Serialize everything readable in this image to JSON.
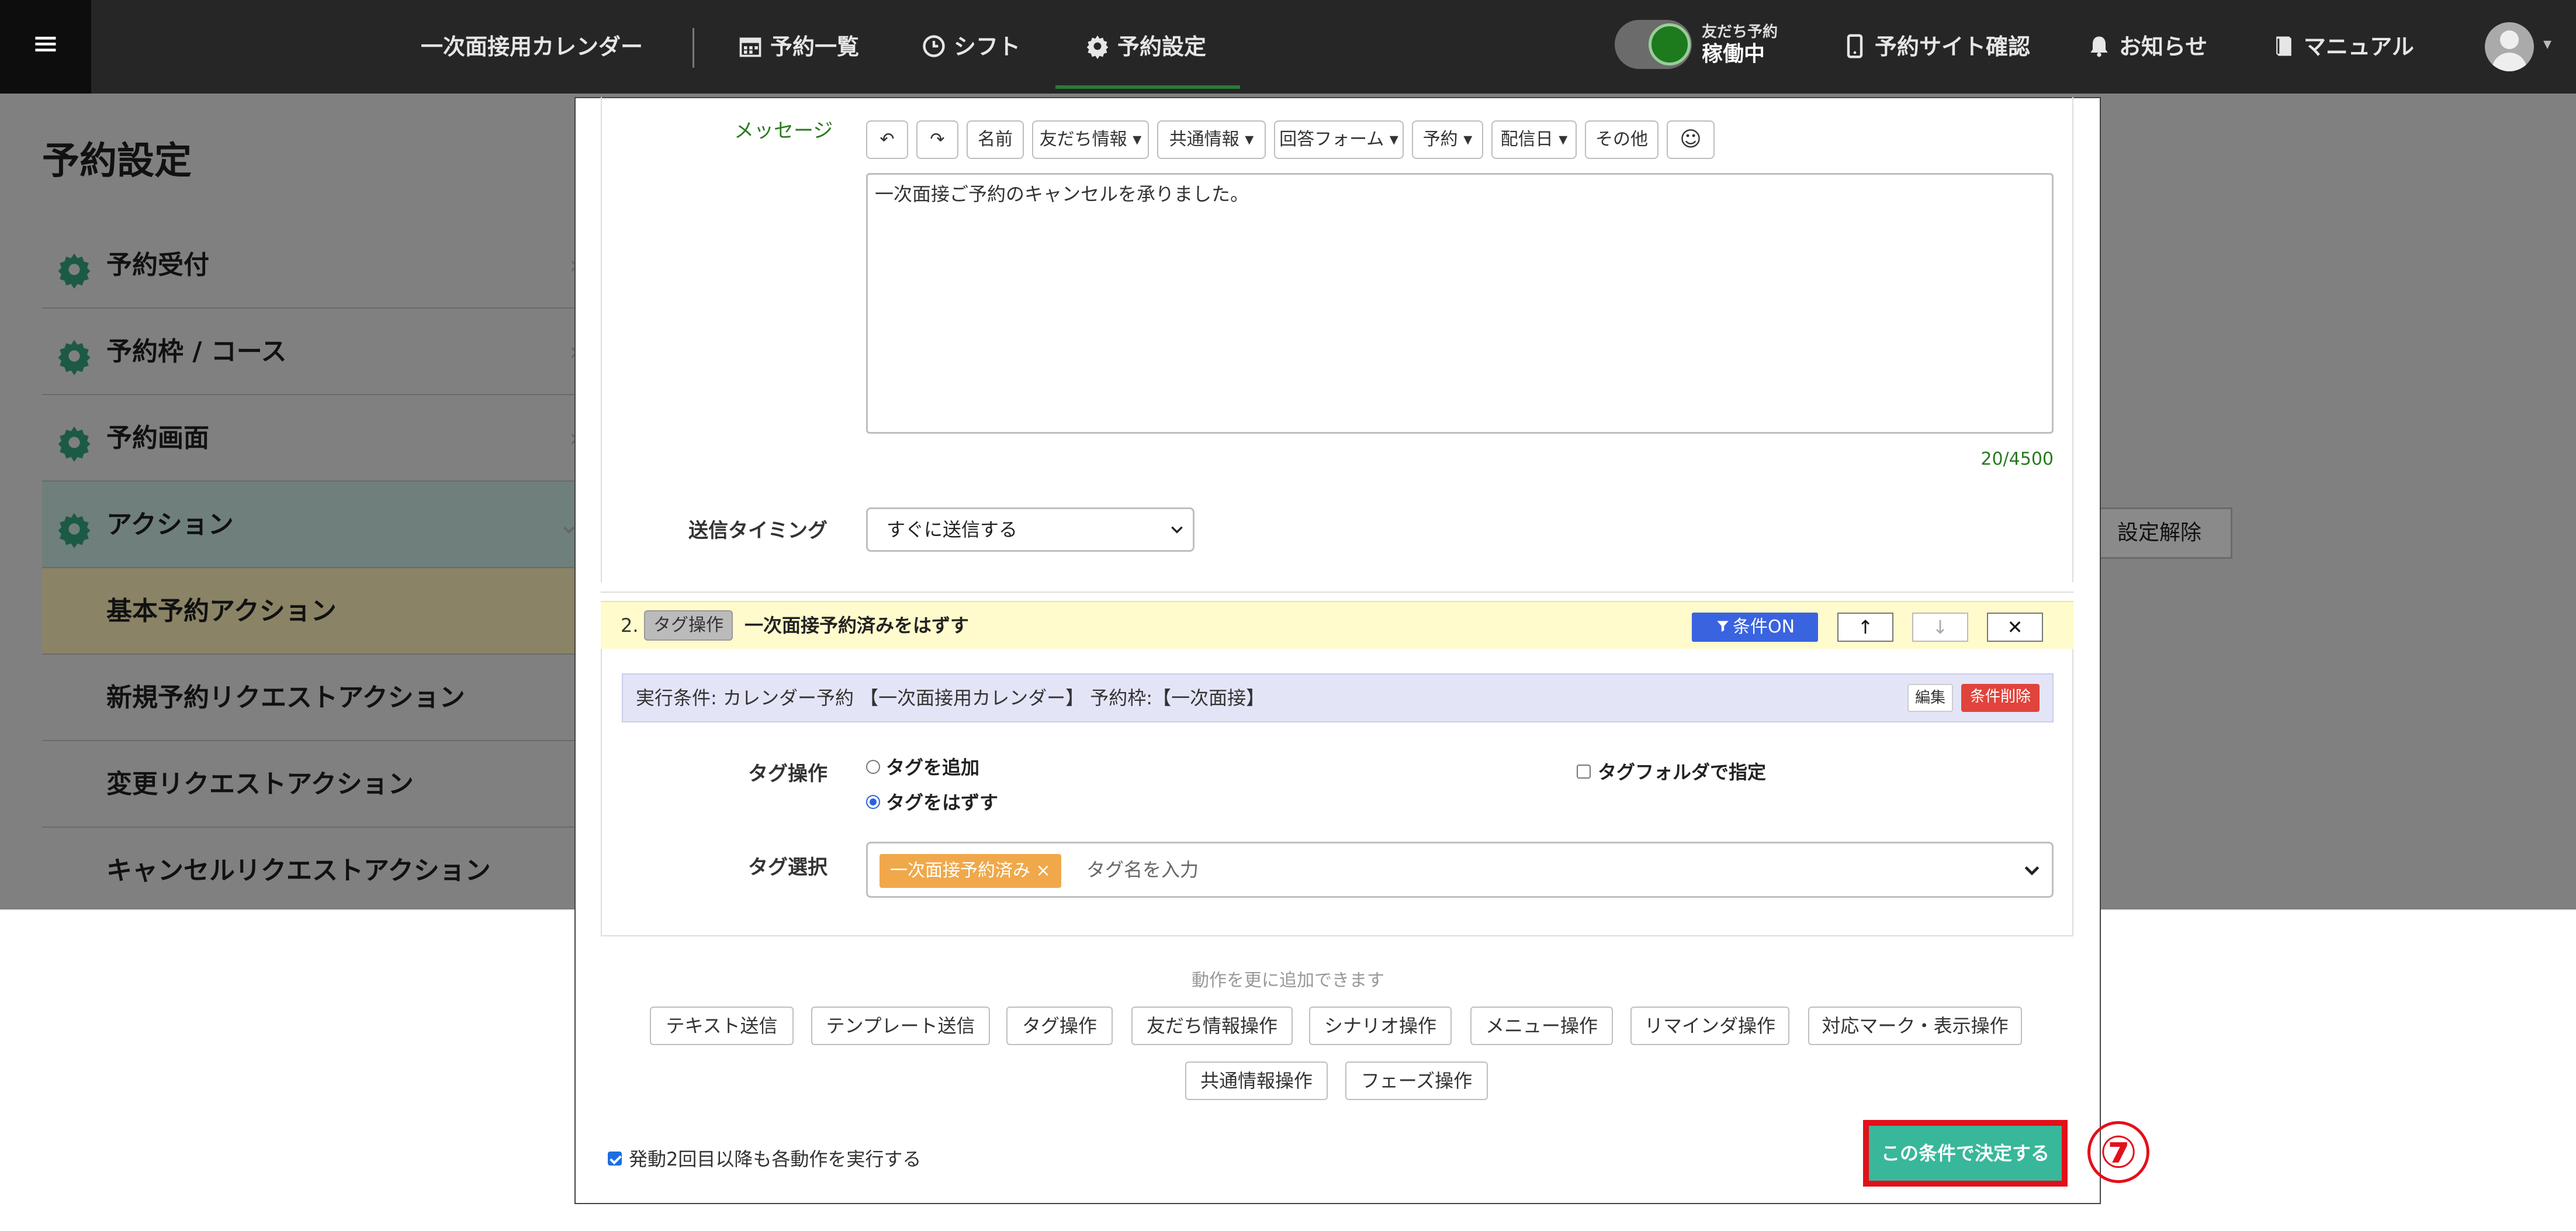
{
  "topbar": {
    "menu_icon": "hamburger-icon",
    "calendar_name": "一次面接用カレンダー",
    "nav": [
      {
        "label": "予約一覧",
        "icon": "calendar-icon"
      },
      {
        "label": "シフト",
        "icon": "clock-icon"
      },
      {
        "label": "予約設定",
        "icon": "gear-icon"
      }
    ],
    "toggle_label_top": "友だち予約",
    "toggle_label_bottom": "稼働中",
    "site_check": "予約サイト確認",
    "notice": "お知らせ",
    "manual": "マニュアル"
  },
  "page": {
    "title": "予約設定",
    "sidebar": [
      {
        "label": "予約受付",
        "icon": "gear-icon"
      },
      {
        "label": "予約枠 / コース",
        "icon": "gear-icon"
      },
      {
        "label": "予約画面",
        "icon": "gear-icon"
      },
      {
        "label": "アクション",
        "icon": "gear-icon"
      }
    ],
    "sub_items": [
      "基本予約アクション",
      "新規予約リクエストアクション",
      "変更リクエストアクション",
      "キャンセルリクエストアクション"
    ],
    "setting_clear": "設定解除"
  },
  "modal": {
    "message_label": "メッセージ",
    "toolbar": {
      "undo": "↶",
      "redo": "↷",
      "name": "名前",
      "friend_info": "友だち情報 ▾",
      "shared_info": "共通情報 ▾",
      "answer_form": "回答フォーム ▾",
      "reservation": "予約 ▾",
      "delivery_date": "配信日 ▾",
      "other": "その他",
      "emoji": "☺"
    },
    "message_text": "一次面接ご予約のキャンセルを承りました。",
    "char_count": "20/4500",
    "timing_label": "送信タイミング",
    "timing_value": "すぐに送信する",
    "action2": {
      "number": "2.",
      "badge": "タグ操作",
      "title": "一次面接予約済みをはずす",
      "condition_on": "条件ON",
      "up": "↑",
      "down": "↓",
      "remove": "✕",
      "exec_condition": "実行条件: カレンダー予約 【一次面接用カレンダー】 予約枠:【一次面接】",
      "edit": "編集",
      "delete_condition": "条件削除",
      "tag_op_label": "タグ操作",
      "radio_add": "タグを追加",
      "radio_remove": "タグをはずす",
      "folder_check": "タグフォルダで指定",
      "tag_select_label": "タグ選択",
      "chip": "一次面接予約済み ×",
      "tag_placeholder": "タグ名を入力"
    },
    "more_hint": "動作を更に追加できます",
    "actions_row1": [
      "テキスト送信",
      "テンプレート送信",
      "タグ操作",
      "友だち情報操作",
      "シナリオ操作",
      "メニュー操作",
      "リマインダ操作",
      "対応マーク・表示操作"
    ],
    "actions_row2": [
      "共通情報操作",
      "フェーズ操作"
    ],
    "repeat_check": "発動2回目以降も各動作を実行する",
    "submit": "この条件で決定する",
    "step_marker": "⑦"
  }
}
